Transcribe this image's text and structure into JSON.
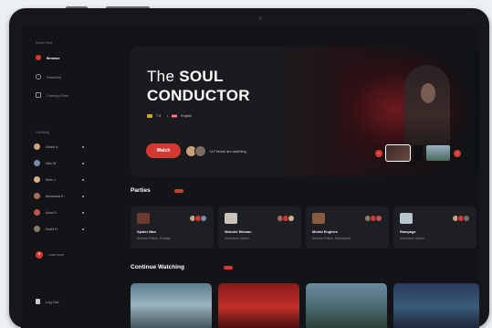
{
  "sidebar": {
    "menu_label": "Menu Feed",
    "nav": [
      {
        "label": "Browse",
        "icon": "browse-icon",
        "active": true
      },
      {
        "label": "Watchlist",
        "icon": "heart-icon",
        "active": false
      },
      {
        "label": "Coming Soon",
        "icon": "calendar-icon",
        "active": false
      }
    ],
    "following_label": "Following",
    "following": [
      {
        "name": "Vladut A.",
        "color": "#c9a27a"
      },
      {
        "name": "Nick W.",
        "color": "#7a8aa8"
      },
      {
        "name": "Ellen J.",
        "color": "#d4b08a"
      },
      {
        "name": "Alexandra K.",
        "color": "#a86a5a"
      },
      {
        "name": "Anna S.",
        "color": "#c0544a"
      },
      {
        "name": "David H.",
        "color": "#8a7a6a"
      }
    ],
    "load_more": "Load more",
    "logout": "Log Out"
  },
  "hero": {
    "title_the": "The",
    "title_line1": "SOUL",
    "title_line2": "CONDUCTOR",
    "rating": "7.6",
    "language": "English",
    "watch_label": "Watch",
    "friends_text": "+4 Friends are watching"
  },
  "parties": {
    "title": "Parties",
    "items": [
      {
        "title": "Spider Man",
        "genres": "Science Fiction, Fantasy",
        "color": "#6a3a30"
      },
      {
        "title": "Wonder Woman",
        "genres": "Adventure, Action",
        "color": "#c9c2b8"
      },
      {
        "title": "Mortal Engines",
        "genres": "Science Fiction, Steampunk",
        "color": "#8a5a40"
      },
      {
        "title": "Rampage",
        "genres": "Adventure, Action",
        "color": "#b8c4cc"
      }
    ]
  },
  "continue": {
    "title": "Continue Watching"
  },
  "colors": {
    "accent": "#d23a31"
  }
}
